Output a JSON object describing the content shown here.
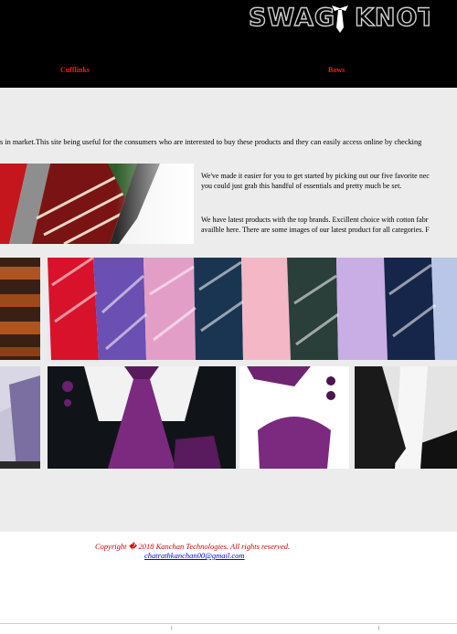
{
  "header": {
    "logo_text_left": "SWAG",
    "logo_text_right": "KNOT",
    "nav": [
      {
        "label": "Cufflinks"
      },
      {
        "label": "Bows"
      }
    ]
  },
  "main": {
    "intro_text": "s in market.This site being useful for the consumers who are interested to buy these products and they can easily access online by checking",
    "desc_line1": "We've made it easier for you to get started by picking out our five favorite nec",
    "desc_line2": "you could just grab this handful of essentials and pretty much be set.",
    "desc_line3": "We have latest products with the top brands. Excillent choice with cotton fabr",
    "desc_line4": "availble here. There are some images of our latest product for all categories. F"
  },
  "footer": {
    "copyright": "Copyright � 2018 Kanchan Technologies. All rights reserved.",
    "email": "chatrathkanchan00@gmail.com"
  },
  "colors": {
    "header_bg": "#000000",
    "nav_link": "#ff1a1a",
    "main_bg": "#ececec",
    "copyright": "#d40000",
    "email_link": "#0000ee"
  }
}
